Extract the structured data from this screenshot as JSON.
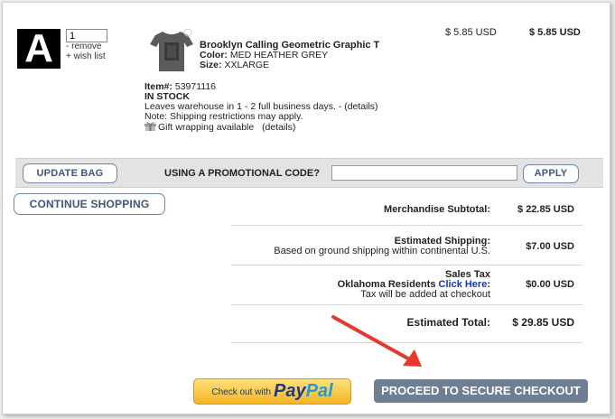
{
  "item": {
    "logo_letter": "A",
    "quantity": "1",
    "remove_label": "- remove",
    "wishlist_label": "+ wish list",
    "title": "Brooklyn Calling Geometric Graphic T",
    "color_label": "Color:",
    "color_value": "MED HEATHER GREY",
    "size_label": "Size:",
    "size_value": "XXLARGE",
    "unit_price": "$ 5.85 USD",
    "line_total": "$ 5.85  USD",
    "item_number_label": "Item#:",
    "item_number": "53971116",
    "stock_status": "IN STOCK",
    "shipping_note": "Leaves warehouse in 1 - 2 full business days. - (details)",
    "restriction_note": "Note: Shipping restrictions may apply.",
    "gift_label": "Gift wrapping available",
    "gift_details": "(details)"
  },
  "promo": {
    "update_bag": "UPDATE BAG",
    "label": "USING A PROMOTIONAL CODE?",
    "code_value": "",
    "apply": "APPLY"
  },
  "continue_shopping": "CONTINUE SHOPPING",
  "totals": {
    "subtotal_label": "Merchandise Subtotal:",
    "subtotal_value": "$ 22.85 USD",
    "shipping_label": "Estimated Shipping:",
    "shipping_sub": "Based on ground shipping within continental U.S.",
    "shipping_value": "$7.00 USD",
    "tax_label": "Sales Tax",
    "tax_ok_prefix": "Oklahoma Residents",
    "tax_link": "Click Here",
    "tax_suffix": ":",
    "tax_note": "Tax will be added at checkout",
    "tax_value": "$0.00 USD",
    "total_label": "Estimated Total:",
    "total_value": "$ 29.85 USD"
  },
  "paypal": {
    "prefix": "Check out with",
    "brand_a": "Pay",
    "brand_b": "Pal"
  },
  "checkout_label": "PROCEED TO SECURE CHECKOUT",
  "colors": {
    "button_text": "#3e5679",
    "link": "#1433c8",
    "arrow": "#e8372f",
    "checkout_bg": "#6e7f95"
  }
}
